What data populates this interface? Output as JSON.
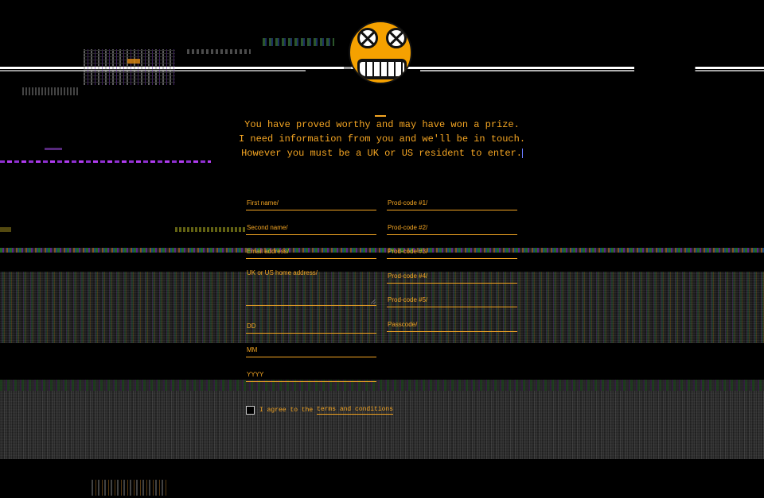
{
  "message": {
    "line1": "You have proved worthy and may have won a prize.",
    "line2": "I need information from you and we'll be in touch.",
    "line3": "However you must be a UK or US resident to enter."
  },
  "form": {
    "left_fields": {
      "first_name": "First name/",
      "second_name": "Second name/",
      "email": "Email address/",
      "address": "UK or US home address/",
      "dd": "DD",
      "mm": "MM",
      "yyyy": "YYYY"
    },
    "right_fields": {
      "prod1": "Prod-code #1/",
      "prod2": "Prod-code #2/",
      "prod3": "Prod-code #3/",
      "prod4": "Prod-code #4/",
      "prod5": "Prod-code #5/",
      "passcode": "Passcode/"
    },
    "agree": {
      "prefix": "I agree to the ",
      "link": "terms and conditions",
      "checked": false
    }
  },
  "colors": {
    "background": "#000000",
    "accent": "#f5a623",
    "logo": "#f5a100"
  },
  "logo": {
    "icon": "skull-smiley-icon"
  }
}
